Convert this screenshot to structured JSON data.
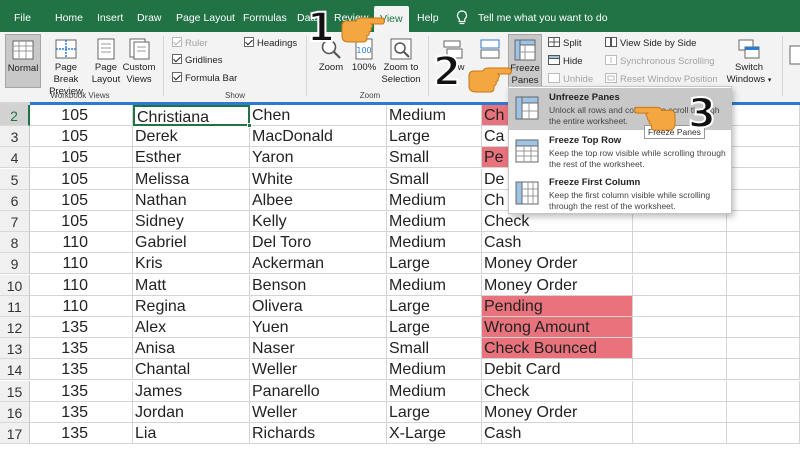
{
  "menubar": {
    "tabs": [
      "File",
      "Home",
      "Insert",
      "Draw",
      "Page Layout",
      "Formulas",
      "Data",
      "Review",
      "View",
      "Help"
    ],
    "active_tab": "View",
    "tell_me": "Tell me what you want to do"
  },
  "ribbon": {
    "workbook_views": {
      "label": "Workbook Views",
      "normal": "Normal",
      "page_break": "Page Break Preview",
      "page_layout": "Page Layout",
      "custom_views": "Custom Views"
    },
    "show": {
      "label": "Show",
      "ruler": "Ruler",
      "gridlines": "Gridlines",
      "formula_bar": "Formula Bar",
      "headings": "Headings"
    },
    "zoom": {
      "label": "Zoom",
      "zoom": "Zoom",
      "hundred": "100%",
      "zoom_selection": "Zoom to Selection"
    },
    "window": {
      "new_window_partial": "w",
      "freeze_panes": "Freeze Panes",
      "split": "Split",
      "hide": "Hide",
      "unhide": "Unhide",
      "side_by_side": "View Side by Side",
      "sync_scroll": "Synchronous Scrolling",
      "reset_position": "Reset Window Position",
      "switch_windows": "Switch Windows"
    }
  },
  "dropdown": {
    "items": [
      {
        "title": "Unfreeze Panes",
        "desc": "Unlock all rows and columns to scroll through the entire worksheet."
      },
      {
        "title": "Freeze Top Row",
        "desc": "Keep the top row visible while scrolling through the rest of the worksheet."
      },
      {
        "title": "Freeze First Column",
        "desc": "Keep the first column visible while scrolling through the rest of the worksheet."
      }
    ],
    "tooltip": "Freeze Panes"
  },
  "steps": [
    "1",
    "2",
    "3"
  ],
  "colors": {
    "excel_green": "#217346",
    "highlight_red": "#e8737c",
    "accent_blue": "#2b7bd0",
    "hand_orange": "#f4a640"
  },
  "sheet": {
    "rows": [
      {
        "n": "2",
        "id": "105",
        "first": "Christiana",
        "last": "Chen",
        "size": "Medium",
        "status": "Ch",
        "red": true
      },
      {
        "n": "3",
        "id": "105",
        "first": "Derek",
        "last": "MacDonald",
        "size": "Large",
        "status": "Ca",
        "red": false
      },
      {
        "n": "4",
        "id": "105",
        "first": "Esther",
        "last": "Yaron",
        "size": "Small",
        "status": "Pe",
        "red": true
      },
      {
        "n": "5",
        "id": "105",
        "first": "Melissa",
        "last": "White",
        "size": "Small",
        "status": "De",
        "red": false
      },
      {
        "n": "6",
        "id": "105",
        "first": "Nathan",
        "last": "Albee",
        "size": "Medium",
        "status": "Ch",
        "red": false
      },
      {
        "n": "7",
        "id": "105",
        "first": "Sidney",
        "last": "Kelly",
        "size": "Medium",
        "status": "Check",
        "red": false
      },
      {
        "n": "8",
        "id": "110",
        "first": "Gabriel",
        "last": "Del Toro",
        "size": "Medium",
        "status": "Cash",
        "red": false
      },
      {
        "n": "9",
        "id": "110",
        "first": "Kris",
        "last": "Ackerman",
        "size": "Large",
        "status": "Money Order",
        "red": false
      },
      {
        "n": "10",
        "id": "110",
        "first": "Matt",
        "last": "Benson",
        "size": "Medium",
        "status": "Money Order",
        "red": false
      },
      {
        "n": "11",
        "id": "110",
        "first": "Regina",
        "last": "Olivera",
        "size": "Large",
        "status": "Pending",
        "red": true
      },
      {
        "n": "12",
        "id": "135",
        "first": "Alex",
        "last": "Yuen",
        "size": "Large",
        "status": "Wrong Amount",
        "red": true
      },
      {
        "n": "13",
        "id": "135",
        "first": "Anisa",
        "last": "Naser",
        "size": "Small",
        "status": "Check Bounced",
        "red": true
      },
      {
        "n": "14",
        "id": "135",
        "first": "Chantal",
        "last": "Weller",
        "size": "Medium",
        "status": "Debit Card",
        "red": false
      },
      {
        "n": "15",
        "id": "135",
        "first": "James",
        "last": "Panarello",
        "size": "Medium",
        "status": "Check",
        "red": false
      },
      {
        "n": "16",
        "id": "135",
        "first": "Jordan",
        "last": "Weller",
        "size": "Large",
        "status": "Money Order",
        "red": false
      },
      {
        "n": "17",
        "id": "135",
        "first": "Lia",
        "last": "Richards",
        "size": "X-Large",
        "status": "Cash",
        "red": false
      }
    ]
  }
}
